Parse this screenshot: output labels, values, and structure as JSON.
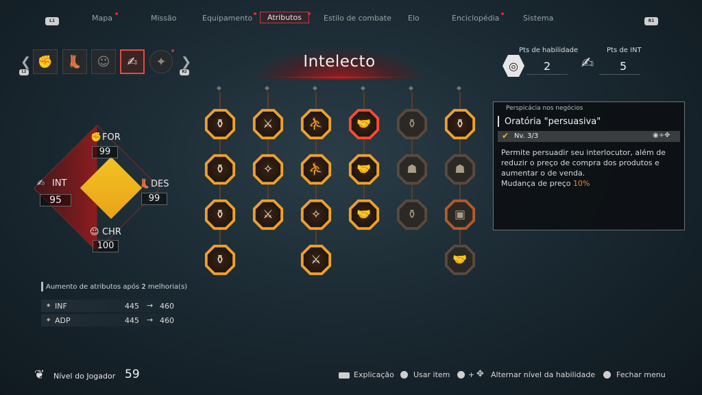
{
  "nav": {
    "left_button": "L1",
    "right_button": "R1",
    "tabs": [
      "Mapa",
      "Missão",
      "Equipamento",
      "Atributos",
      "Estilo de combate",
      "Elo",
      "Enciclopédia",
      "Sistema"
    ],
    "active_tab": "Atributos"
  },
  "char_tabs": {
    "left_button": "L2",
    "right_button": "R2",
    "icons": [
      "fist-icon",
      "boot-icon",
      "charisma-icon",
      "intellect-icon",
      "eagle-icon"
    ],
    "active_index": 3
  },
  "title": "Intelecto",
  "points": {
    "skill_label": "Pts de habilidade",
    "skill_value": "2",
    "int_label": "Pts de INT",
    "int_value": "5"
  },
  "stats": {
    "for_label": "FOR",
    "for_value": "99",
    "int_label": "INT",
    "int_value": "95",
    "des_label": "DES",
    "des_value": "99",
    "chr_label": "CHR",
    "chr_value": "100"
  },
  "increase": {
    "title_before": "Aumento de atributos após ",
    "title_count": "2",
    "title_after": " melhoria(s)",
    "rows": [
      {
        "name": "INF",
        "from": "445",
        "arrow": "→",
        "to": "460"
      },
      {
        "name": "ADP",
        "from": "445",
        "arrow": "→",
        "to": "460"
      }
    ]
  },
  "skill_grid": {
    "columns": 6,
    "nodes": [
      [
        "bottle",
        "sword",
        "fighter",
        "handshake",
        "bottle",
        "bottle"
      ],
      [
        "bottle",
        "sword-stars",
        "fighter",
        "handshake",
        "group",
        "group"
      ],
      [
        "bottle",
        "sword",
        "sword-stars",
        "handshake",
        "bottle",
        "box"
      ],
      [
        "bottle",
        "",
        "sword",
        "",
        "",
        "handshake"
      ]
    ],
    "selected": {
      "row": 0,
      "col": 3
    }
  },
  "info": {
    "category": "Perspicácia nos negócios",
    "skill_name": "Oratória \"persuasiva\"",
    "level": "Nv. 3/3",
    "desc_line1": "Permite persuadir seu interlocutor, além de",
    "desc_line2": "reduzir o preço de compra dos produtos e",
    "desc_line3": "aumentar o de venda.",
    "effect_label": "Mudança de preço ",
    "effect_value": "10%",
    "accent_color": "#e8862a"
  },
  "player": {
    "label": "Nível do Jogador",
    "level": "59"
  },
  "hints": [
    {
      "label": "Explicação"
    },
    {
      "label": "Usar item"
    },
    {
      "label": "Alternar nível da habilidade"
    },
    {
      "label": "Fechar menu"
    }
  ],
  "hint_plus": "+"
}
